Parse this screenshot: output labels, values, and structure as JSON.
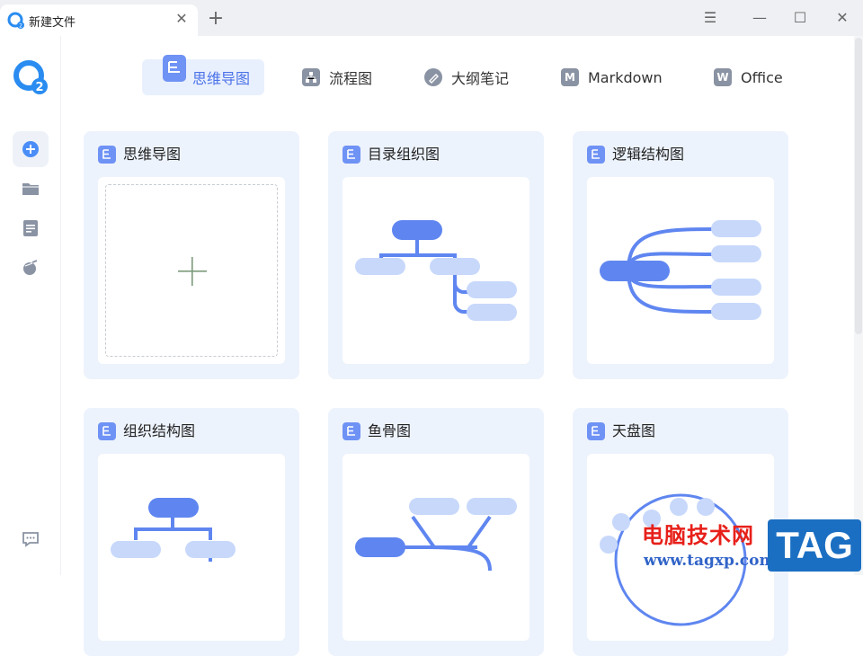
{
  "window": {
    "tab_title": "新建文件",
    "tab_close": "✕",
    "new_tab": "+",
    "menu": "☰",
    "minimize": "—",
    "maximize": "☐",
    "close": "✕"
  },
  "sidebar": {
    "items": [
      {
        "name": "new",
        "icon": "plus-circle-icon"
      },
      {
        "name": "folder",
        "icon": "folder-icon"
      },
      {
        "name": "document",
        "icon": "document-icon"
      },
      {
        "name": "acorn",
        "icon": "acorn-icon"
      }
    ],
    "bottom": "chat-icon"
  },
  "topnav": {
    "items": [
      {
        "label": "思维导图",
        "icon": "mindmap-icon",
        "active": true
      },
      {
        "label": "流程图",
        "icon": "flowchart-icon"
      },
      {
        "label": "大纲笔记",
        "icon": "outline-icon"
      },
      {
        "label": "Markdown",
        "icon": "markdown-icon",
        "glyph": "M"
      },
      {
        "label": "Office",
        "icon": "office-icon",
        "glyph": "W"
      }
    ]
  },
  "templates": [
    {
      "title": "思维导图",
      "kind": "blank"
    },
    {
      "title": "目录组织图",
      "kind": "directory"
    },
    {
      "title": "逻辑结构图",
      "kind": "logic"
    },
    {
      "title": "组织结构图",
      "kind": "org"
    },
    {
      "title": "鱼骨图",
      "kind": "fishbone"
    },
    {
      "title": "天盘图",
      "kind": "radial"
    }
  ],
  "watermark": {
    "site_name": "电脑技术网",
    "url": "www.tagxp.com",
    "badge": "TAG"
  },
  "colors": {
    "accent": "#4b72e8",
    "node_dark": "#5f86f0",
    "node_light": "#c7d8fb",
    "card_bg": "#edf3fc"
  }
}
